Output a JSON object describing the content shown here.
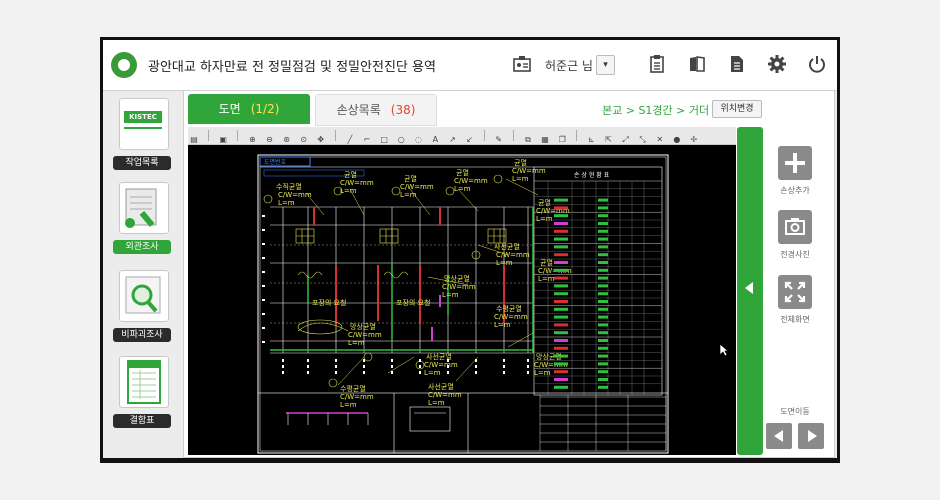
{
  "header": {
    "title": "광안대교 하자만료 전 정밀점검 및 정밀안전진단 용역",
    "user_name": "허준근 님",
    "user_dropdown_glyph": "▾",
    "icons": [
      "clipboard-icon",
      "book-icon",
      "document-icon",
      "gear-icon",
      "power-icon"
    ]
  },
  "sidebar": {
    "logo_text": "KISTEC",
    "items": [
      {
        "label": "작업목록",
        "icon": "kistec-logo-icon",
        "active": false
      },
      {
        "label": "외관조사",
        "icon": "drawing-roll-icon",
        "active": true
      },
      {
        "label": "비파괴조사",
        "icon": "magnifier-icon",
        "active": false
      },
      {
        "label": "결함표",
        "icon": "spreadsheet-icon",
        "active": false
      }
    ]
  },
  "tabs": [
    {
      "label": "도면",
      "count": "(1/2)",
      "active": true
    },
    {
      "label": "손상목록",
      "count": "(38)",
      "active": false
    }
  ],
  "breadcrumb": "본교 > S1경간 > 거더",
  "location_button": "위치변경",
  "right_panel": {
    "add_damage": "손상추가",
    "photo": "전경사진",
    "fullscreen": "전체화면",
    "navigation": "도면이동"
  },
  "drawing": {
    "top_label": "도면번호",
    "labels": [
      {
        "text": "수직균열",
        "sub": [
          "C/W=mm",
          "L=m"
        ]
      },
      {
        "text": "균열",
        "sub": [
          "C/W=mm",
          "L=m"
        ]
      },
      {
        "text": "균열",
        "sub": [
          "C/W=mm",
          "L=m"
        ]
      },
      {
        "text": "균열",
        "sub": [
          "C/W=mm",
          "L=m"
        ]
      },
      {
        "text": "균열",
        "sub": [
          "C/W=mm",
          "L=m"
        ]
      },
      {
        "text": "사선균열",
        "sub": [
          "C/W=mm",
          "L=m"
        ]
      },
      {
        "text": "망상균열",
        "sub": [
          "C/W=mm",
          "L=m"
        ]
      },
      {
        "text": "포장의 요철",
        "sub": []
      },
      {
        "text": "포장의 요철",
        "sub": []
      },
      {
        "text": "수평균열",
        "sub": [
          "C/W=mm",
          "L=m"
        ]
      },
      {
        "text": "망상균열",
        "sub": [
          "C/W=mm",
          "L=m"
        ]
      },
      {
        "text": "사선균열",
        "sub": [
          "C/W=mm",
          "L=m"
        ]
      },
      {
        "text": "수평균열",
        "sub": [
          "C/W=mm",
          "L=m"
        ]
      },
      {
        "text": "사선균열",
        "sub": [
          "C/W=mm",
          "L=m"
        ]
      },
      {
        "text": "망상균열",
        "sub": [
          "C/W=mm",
          "L=m"
        ]
      },
      {
        "text": "균열",
        "sub": [
          "C/W=mm",
          "L=m"
        ]
      },
      {
        "text": "균열",
        "sub": [
          "C/W=mm",
          "L=m"
        ]
      }
    ],
    "table_title": "손 상 현 황 표",
    "colors": {
      "yellow": "#e8e84a",
      "red": "#d83030",
      "green": "#30c040",
      "magenta": "#d040d0",
      "white": "#ffffff"
    }
  }
}
